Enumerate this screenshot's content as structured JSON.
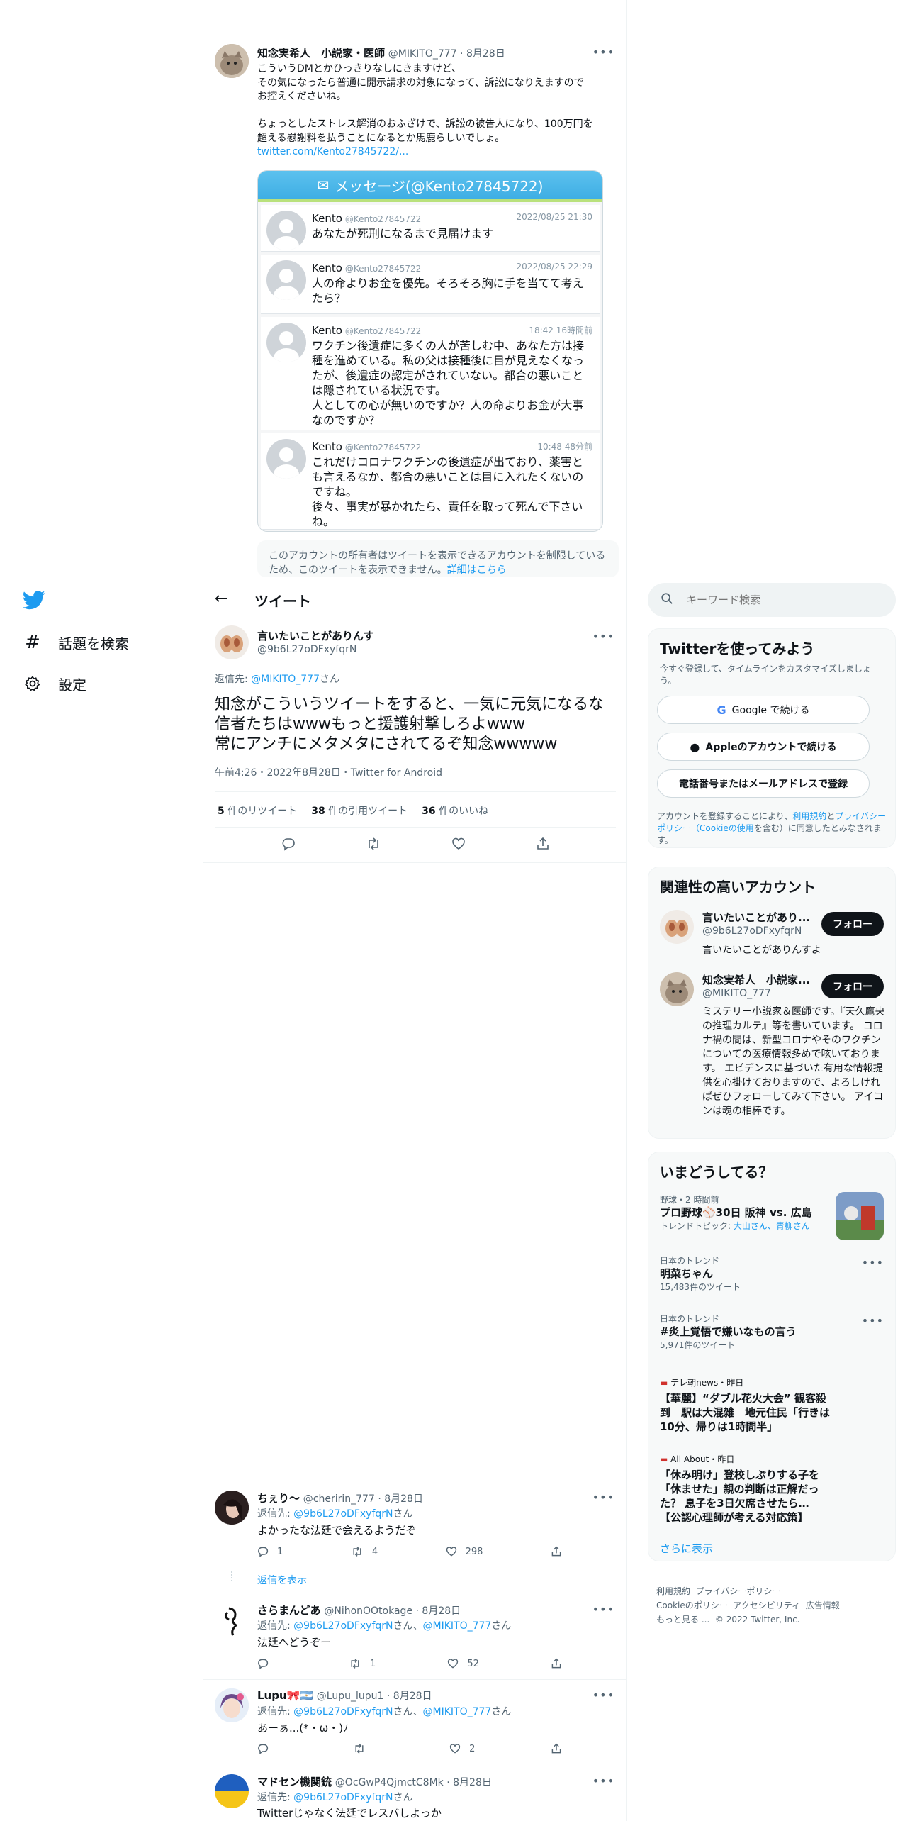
{
  "nav": {
    "explore_label": "話題を検索",
    "settings_label": "設定"
  },
  "quoted_tweet": {
    "author_name": "知念実希人　小説家・医師",
    "author_handle": "@MIKITO_777",
    "date": "8月28日",
    "text_lines": [
      "こういうDMとかひっきりなしにきますけど、",
      "その気になったら普通に開示請求の対象になって、訴訟になりえますので",
      "お控えくださいね。",
      "",
      "ちょっとしたストレス解消のおふざけで、訴訟の被告人になり、100万円を",
      "超える慰謝料を払うことになるとか馬鹿らしいでしょ。"
    ],
    "link": "twitter.com/Kento27845722/...",
    "dm_header": "メッセージ(@Kento27845722)",
    "dm_messages": [
      {
        "name": "Kento",
        "handle": "@Kento27845722",
        "time": "2022/08/25 21:30",
        "text": "あなたが死刑になるまで見届けます"
      },
      {
        "name": "Kento",
        "handle": "@Kento27845722",
        "time": "2022/08/25 22:29",
        "text": "人の命よりお金を優先。そろそろ胸に手を当てて考えたら？"
      },
      {
        "name": "Kento",
        "handle": "@Kento27845722",
        "time": "18:42 16時間前",
        "text": "ワクチン後遺症に多くの人が苦しむ中、あなた方は接種を進めている。私の父は接種後に目が見えなくなったが、後遺症の認定がされていない。都合の悪いことは隠されている状況です。\n人としての心が無いのですか？人の命よりお金が大事なのですか？"
      },
      {
        "name": "Kento",
        "handle": "@Kento27845722",
        "time": "10:48 48分前",
        "text": "これだけコロナワクチンの後遺症が出ており、薬害とも言えるなか、都合の悪いことは目に入れたくないのですね。\n後々、事実が暴かれたら、責任を取って死んで下さいね。"
      }
    ],
    "unavailable_notice": "このアカウントの所有者はツイートを表示できるアカウントを制限しているため、このツイートを表示できません。",
    "unavailable_link": "詳細はこちら"
  },
  "header": {
    "title": "ツイート"
  },
  "main_tweet": {
    "author_name": "言いたいことがありんす",
    "author_handle": "@9b6L27oDFxyfqrN",
    "reply_to_prefix": "返信先: ",
    "reply_to_handle": "@MIKITO_777",
    "reply_to_suffix": "さん",
    "text": "知念がこういうツイートをすると、一気に元気になるな信者たちはwwwもっと援護射撃しろよwww\n常にアンチにメタメタにされてるぞ知念wwwww",
    "meta": "午前4:26・2022年8月28日・Twitter for Android",
    "stats": [
      {
        "count": "5",
        "label": "件のリツイート"
      },
      {
        "count": "38",
        "label": "件の引用ツイート"
      },
      {
        "count": "36",
        "label": "件のいいね"
      }
    ]
  },
  "replies": [
    {
      "name": "ちぇり～",
      "handle": "@cheririn_777",
      "date": "8月28日",
      "reply_to": [
        "@9b6L27oDFxyfqrN"
      ],
      "text": "よかったな法廷で会えるようだぞ",
      "reply_count": "1",
      "retweet_count": "4",
      "like_count": "298",
      "show_replies": "返信を表示"
    },
    {
      "name": "さらまんどあ",
      "handle": "@NihonOOtokage",
      "date": "8月28日",
      "reply_to": [
        "@9b6L27oDFxyfqrN",
        "@MIKITO_777"
      ],
      "text": "法廷へどうぞー",
      "reply_count": "",
      "retweet_count": "1",
      "like_count": "52"
    },
    {
      "name": "Lupu🎀🇦🇷",
      "handle": "@Lupu_lupu1",
      "date": "8月28日",
      "reply_to": [
        "@9b6L27oDFxyfqrN",
        "@MIKITO_777"
      ],
      "text": "あーぁ...(*・ω・)ﾉ",
      "reply_count": "",
      "retweet_count": "",
      "like_count": "2"
    },
    {
      "name": "マドセン機関銃",
      "handle": "@OcGwP4QjmctC8Mk",
      "date": "8月28日",
      "reply_to": [
        "@9b6L27oDFxyfqrN"
      ],
      "text": "Twitterじゃなく法廷でレスバしよっか"
    }
  ],
  "search": {
    "placeholder": "キーワード検索"
  },
  "signup": {
    "title": "Twitterを使ってみよう",
    "subtitle": "今すぐ登録して、タイムラインをカスタマイズしましょう。",
    "google_label": "Google で続ける",
    "apple_label": "Appleのアカウントで続ける",
    "email_label": "電話番号またはメールアドレスで登録",
    "legal_prefix": "アカウントを登録することにより、",
    "legal_terms": "利用規約",
    "legal_and": "と",
    "legal_privacy": "プライバシーポリシー",
    "legal_cookie": "（Cookieの使用",
    "legal_suffix": "を含む）に同意したとみなされます。"
  },
  "relevant": {
    "title": "関連性の高いアカウント",
    "follow_label": "フォロー",
    "accounts": [
      {
        "name": "言いたいことがあり...",
        "handle": "@9b6L27oDFxyfqrN",
        "bio": "言いたいことがありんすよ"
      },
      {
        "name": "知念実希人　小説家...",
        "handle": "@MIKITO_777",
        "bio": "ミステリー小説家＆医師です。『天久鷹央の推理カルテ』等を書いています。 コロナ禍の間は、新型コロナやそのワクチンについての医療情報多めで呟いております。 エビデンスに基づいた有用な情報提供を心掛けておりますので、よろしければぜひフォローしてみて下さい。 アイコンは魂の相棒です。"
      }
    ]
  },
  "trends": {
    "title": "いまどうしてる？",
    "items": [
      {
        "category": "野球・2 時間前",
        "title": "プロ野球⚾30日 阪神 vs. 広島",
        "sub_prefix": "トレンドトピック: ",
        "sub_links": "大山さん、青柳さん"
      },
      {
        "category": "日本のトレンド",
        "title": "明菜ちゃん",
        "count": "15,483件のツイート"
      },
      {
        "category": "日本のトレンド",
        "title": "#炎上覚悟で嫌いなもの言う",
        "count": "5,971件のツイート"
      },
      {
        "category": "テレ朝news・昨日",
        "title": "【華麗】“ダブル花火大会” 観客殺到　駅は大混雑　地元住民「行きは10分、帰りは1時間半」"
      },
      {
        "category": "All About・昨日",
        "title": "「休み明け」登校しぶりする子を「休ませた」親の判断は正解だった？ 息子を3日欠席させたら…【公認心理師が考える対応策】"
      }
    ],
    "show_more": "さらに表示"
  },
  "footer": {
    "links": [
      "利用規約",
      "プライバシーポリシー",
      "Cookieのポリシー",
      "アクセシビリティ",
      "広告情報",
      "もっと見る ..."
    ],
    "copyright": "© 2022 Twitter, Inc."
  },
  "colors": {
    "accent": "#1d9bf0",
    "text": "#0f1419",
    "muted": "#536471"
  }
}
